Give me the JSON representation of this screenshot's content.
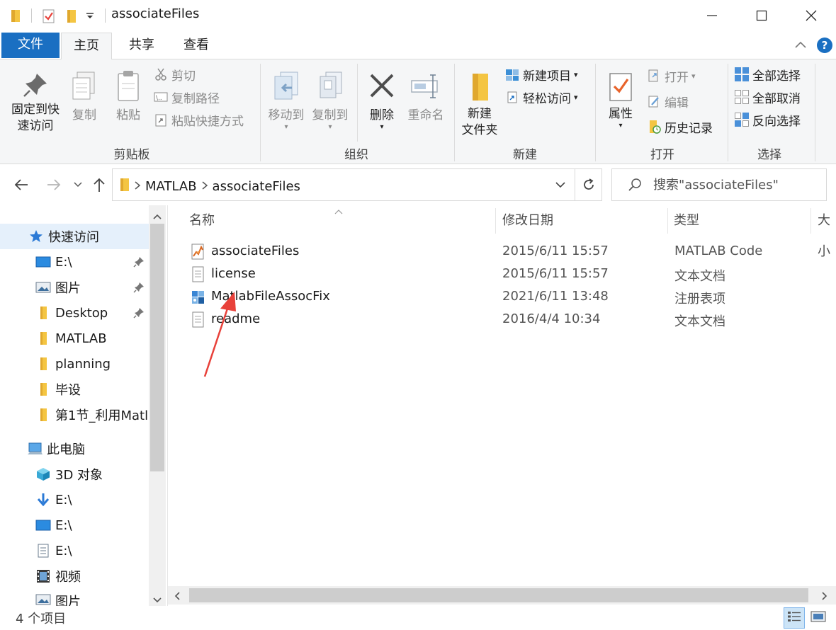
{
  "window": {
    "title": "associateFiles",
    "minimize_glyph": "—",
    "maximize_glyph": "☐",
    "close_glyph": "✕"
  },
  "ribbon_tabs": {
    "file": "文件",
    "home": "主页",
    "share": "共享",
    "view": "查看"
  },
  "ribbon": {
    "clipboard": {
      "label": "剪贴板",
      "pin_quick_line1": "固定到快",
      "pin_quick_line2": "速访问",
      "copy": "复制",
      "paste": "粘贴",
      "cut": "剪切",
      "copy_path": "复制路径",
      "paste_shortcut": "粘贴快捷方式"
    },
    "organize": {
      "label": "组织",
      "move_to": "移动到",
      "copy_to": "复制到",
      "delete": "删除",
      "rename": "重命名"
    },
    "new": {
      "label": "新建",
      "new_folder_line1": "新建",
      "new_folder_line2": "文件夹",
      "new_item": "新建项目",
      "easy_access": "轻松访问"
    },
    "open": {
      "label": "打开",
      "properties": "属性",
      "open": "打开",
      "edit": "编辑",
      "history": "历史记录"
    },
    "select": {
      "label": "选择",
      "select_all": "全部选择",
      "select_none": "全部取消",
      "invert": "反向选择"
    }
  },
  "address": {
    "crumbs": [
      "MATLAB",
      "associateFiles"
    ],
    "search_placeholder": "搜索\"associateFiles\""
  },
  "sidebar": {
    "quick_access": "快速访问",
    "quick_items": [
      {
        "label": "E:\\",
        "pinned": true
      },
      {
        "label": "图片",
        "pinned": true
      },
      {
        "label": "Desktop",
        "pinned": true
      },
      {
        "label": "MATLAB",
        "pinned": false
      },
      {
        "label": "planning",
        "pinned": false
      },
      {
        "label": "毕设",
        "pinned": false
      },
      {
        "label": "第1节_利用Matl",
        "pinned": false
      }
    ],
    "this_pc": "此电脑",
    "pc_items": [
      {
        "label": "3D 对象"
      },
      {
        "label": "E:\\"
      },
      {
        "label": "E:\\"
      },
      {
        "label": "E:\\"
      },
      {
        "label": "视频"
      },
      {
        "label": "图片"
      }
    ]
  },
  "columns": {
    "name": "名称",
    "date": "修改日期",
    "type": "类型",
    "size": "大小"
  },
  "files": [
    {
      "name": "associateFiles",
      "date": "2015/6/11 15:57",
      "type": "MATLAB Code",
      "icon": "matlab-file-icon"
    },
    {
      "name": "license",
      "date": "2015/6/11 15:57",
      "type": "文本文档",
      "icon": "text-file-icon"
    },
    {
      "name": "MatlabFileAssocFix",
      "date": "2021/6/11 13:48",
      "type": "注册表项",
      "icon": "registry-file-icon"
    },
    {
      "name": "readme",
      "date": "2016/4/4 10:34",
      "type": "文本文档",
      "icon": "text-file-icon"
    }
  ],
  "status": {
    "item_count": "4 个项目"
  },
  "colors": {
    "accent": "#1a6fc2",
    "annotation_arrow": "#e8413a",
    "folder": "#f4c542"
  }
}
